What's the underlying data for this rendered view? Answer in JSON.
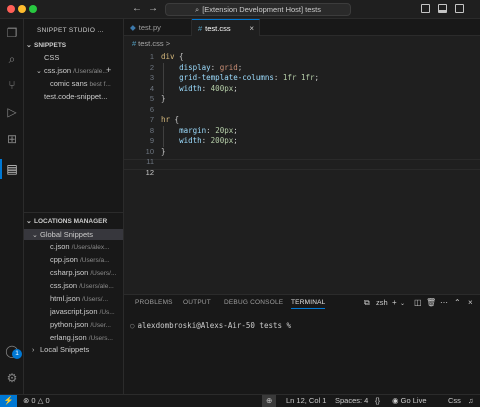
{
  "titlebar": {
    "command_center": "[Extension Development Host] tests",
    "search_icon": "search-icon"
  },
  "activity_bar": {
    "items": [
      "files-icon",
      "search-icon",
      "source-control-icon",
      "run-debug-icon",
      "extensions-icon",
      "snippets-icon"
    ],
    "account_badge": "1"
  },
  "sidebar": {
    "title": "SNIPPET STUDIO ...",
    "snippets_section": "SNIPPETS",
    "snippets": {
      "group": "CSS",
      "file": "css.json",
      "file_path": "/Users/ale...",
      "snippet_name": "comic sans",
      "snippet_desc": "best f...",
      "other_file": "test.code-snippet..."
    },
    "locations_section": "LOCATIONS MANAGER",
    "global_group": "Global Snippets",
    "global_files": [
      {
        "name": "c.json",
        "path": "/Users/alex..."
      },
      {
        "name": "cpp.json",
        "path": "/Users/a..."
      },
      {
        "name": "csharp.json",
        "path": "/Users/..."
      },
      {
        "name": "css.json",
        "path": "/Users/ale..."
      },
      {
        "name": "html.json",
        "path": "/Users/..."
      },
      {
        "name": "javascript.json",
        "path": "/Us..."
      },
      {
        "name": "python.json",
        "path": "/User..."
      },
      {
        "name": "erlang.json",
        "path": "/Users..."
      }
    ],
    "local_group": "Local Snippets"
  },
  "editor": {
    "tabs": [
      {
        "label": "test.py",
        "active": false
      },
      {
        "label": "test.css",
        "active": true
      }
    ],
    "breadcrumb": "test.css",
    "breadcrumb_sep": ">",
    "lines": [
      {
        "n": "1",
        "text": "div {"
      },
      {
        "n": "2",
        "text": "    display: grid;"
      },
      {
        "n": "3",
        "text": "    grid-template-columns: 1fr 1fr;"
      },
      {
        "n": "4",
        "text": "    width: 400px;"
      },
      {
        "n": "5",
        "text": "}"
      },
      {
        "n": "6",
        "text": ""
      },
      {
        "n": "7",
        "text": "hr {"
      },
      {
        "n": "8",
        "text": "    margin: 20px;"
      },
      {
        "n": "9",
        "text": "    width: 200px;"
      },
      {
        "n": "10",
        "text": "}"
      },
      {
        "n": "11",
        "text": ""
      },
      {
        "n": "12",
        "text": ""
      }
    ],
    "current_line": "12"
  },
  "panel": {
    "tabs": [
      "PROBLEMS",
      "OUTPUT",
      "DEBUG CONSOLE",
      "TERMINAL"
    ],
    "active_tab": "TERMINAL",
    "terminal_name": "zsh",
    "prompt": "alexdombroski@Alexs-Air-50 tests %"
  },
  "statusbar": {
    "problems": "0",
    "warnings": "0",
    "cursor": "Ln 12, Col 1",
    "spaces": "Spaces: 4",
    "go_live": "Go Live",
    "language": "Css"
  },
  "colors": {
    "accent": "#0078d4",
    "selector": "#d7ba7d",
    "property": "#9cdcfe",
    "string_value": "#ce9178",
    "number": "#b5cea8"
  }
}
